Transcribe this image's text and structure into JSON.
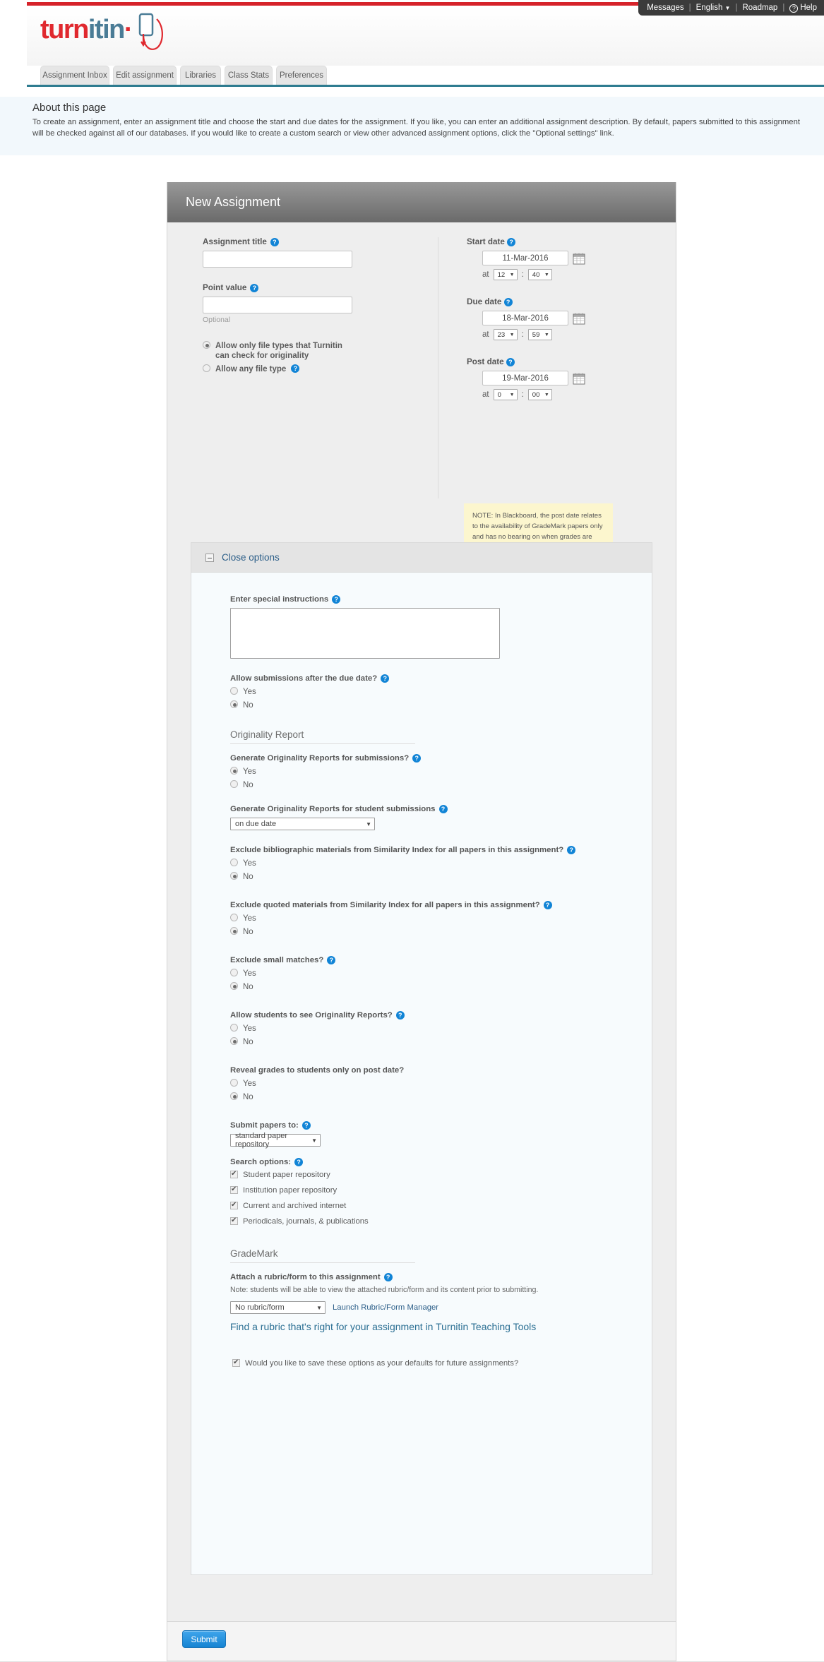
{
  "utility_nav": {
    "items": [
      {
        "label": "Messages",
        "icon": null
      },
      {
        "label": "English",
        "icon": "chevron-down-icon"
      },
      {
        "label": "Roadmap",
        "icon": null
      },
      {
        "label": "Help",
        "icon": "help-circle-icon"
      }
    ],
    "separator": "|"
  },
  "brand": {
    "name_part1": "turn",
    "name_part2": "itin",
    "name_part3": "·"
  },
  "tabs": [
    {
      "label": "Assignment Inbox",
      "selected": false
    },
    {
      "label": "Edit assignment",
      "selected": false
    },
    {
      "label": "Libraries",
      "selected": false
    },
    {
      "label": "Class Stats",
      "selected": false
    },
    {
      "label": "Preferences",
      "selected": false
    }
  ],
  "about": {
    "heading": "About this page",
    "body": "To create an assignment, enter an assignment title and choose the start and due dates for the assignment. If you like, you can enter an additional assignment description. By default, papers submitted to this assignment will be checked against all of our databases. If you would like to create a custom search or view other advanced assignment options, click the \"Optional settings\" link."
  },
  "panel": {
    "title": "New Assignment"
  },
  "form": {
    "assignment_title": {
      "label": "Assignment title",
      "value": "",
      "help": "?"
    },
    "point_value": {
      "label": "Point value",
      "value": "",
      "hint": "Optional",
      "help": "?"
    },
    "file_type": {
      "options": [
        {
          "label": "Allow only file types that Turnitin can check for originality",
          "selected": true,
          "help": null
        },
        {
          "label": "Allow any file type",
          "selected": false,
          "help": "?"
        }
      ]
    },
    "start_date": {
      "label": "Start date",
      "date": "11-Mar-2016",
      "at": "at",
      "hour": "12",
      "sep": ":",
      "minute": "40",
      "help": "?"
    },
    "due_date": {
      "label": "Due date",
      "date": "18-Mar-2016",
      "at": "at",
      "hour": "23",
      "sep": ":",
      "minute": "59",
      "help": "?"
    },
    "post_date": {
      "label": "Post date",
      "date": "19-Mar-2016",
      "at": "at",
      "hour": "0",
      "sep": ":",
      "minute": "00",
      "help": "?"
    },
    "note": "NOTE: In Blackboard, the post date relates to the availability of GradeMark papers only and has no bearing on when grades are posted to the Blackboard Grade Center."
  },
  "options": {
    "toggle_label": "Close options",
    "special_instructions": {
      "label": "Enter special instructions",
      "value": "",
      "help": "?"
    },
    "allow_late": {
      "label": "Allow submissions after the due date?",
      "help": "?",
      "options": [
        {
          "label": "Yes",
          "selected": false
        },
        {
          "label": "No",
          "selected": true
        }
      ]
    },
    "originality_section_title": "Originality Report",
    "generate_reports": {
      "label": "Generate Originality Reports for submissions?",
      "help": "?",
      "options": [
        {
          "label": "Yes",
          "selected": true
        },
        {
          "label": "No",
          "selected": false
        }
      ]
    },
    "generate_student": {
      "label": "Generate Originality Reports for student submissions",
      "help": "?",
      "value": "on due date"
    },
    "exclude_biblio": {
      "label": "Exclude bibliographic materials from Similarity Index for all papers in this assignment?",
      "help": "?",
      "options": [
        {
          "label": "Yes",
          "selected": false
        },
        {
          "label": "No",
          "selected": true
        }
      ]
    },
    "exclude_quoted": {
      "label": "Exclude quoted materials from Similarity Index for all papers in this assignment?",
      "help": "?",
      "options": [
        {
          "label": "Yes",
          "selected": false
        },
        {
          "label": "No",
          "selected": true
        }
      ]
    },
    "exclude_small": {
      "label": "Exclude small matches?",
      "help": "?",
      "options": [
        {
          "label": "Yes",
          "selected": false
        },
        {
          "label": "No",
          "selected": true
        }
      ]
    },
    "students_see_reports": {
      "label": "Allow students to see Originality Reports?",
      "help": "?",
      "options": [
        {
          "label": "Yes",
          "selected": false
        },
        {
          "label": "No",
          "selected": true
        }
      ]
    },
    "reveal_grades": {
      "label": "Reveal grades to students only on post date?",
      "help": null,
      "options": [
        {
          "label": "Yes",
          "selected": false
        },
        {
          "label": "No",
          "selected": true
        }
      ]
    },
    "submit_papers_to": {
      "label": "Submit papers to:",
      "help": "?",
      "value": "standard paper repository"
    },
    "search_options": {
      "label": "Search options:",
      "help": "?",
      "items": [
        {
          "label": "Student paper repository",
          "checked": true
        },
        {
          "label": "Institution paper repository",
          "checked": true
        },
        {
          "label": "Current and archived internet",
          "checked": true
        },
        {
          "label": "Periodicals, journals, & publications",
          "checked": true
        }
      ]
    },
    "grademark_section_title": "GradeMark",
    "attach_rubric": {
      "label": "Attach a rubric/form to this assignment",
      "help": "?",
      "note": "Note: students will be able to view the attached rubric/form and its content prior to submitting.",
      "value": "No rubric/form",
      "manager_link": "Launch Rubric/Form Manager"
    },
    "find_rubric_link": "Find a rubric that's right for your assignment in Turnitin Teaching Tools",
    "save_defaults": {
      "label": "Would you like to save these options as your defaults for future assignments?",
      "checked": true
    }
  },
  "footer": {
    "submit_label": "Submit"
  }
}
